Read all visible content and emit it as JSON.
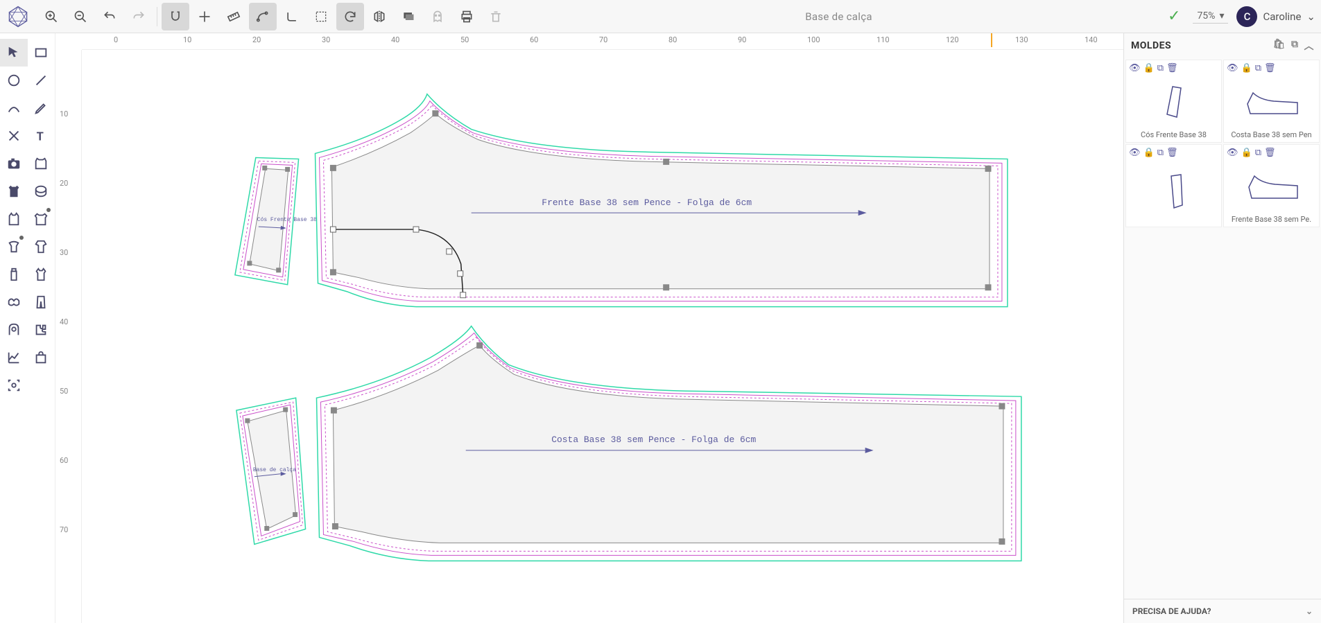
{
  "document_title": "Base de calça",
  "zoom_level": "75%",
  "user": {
    "initial": "C",
    "name": "Caroline"
  },
  "ruler_h": [
    "0",
    "10",
    "20",
    "30",
    "40",
    "50",
    "60",
    "70",
    "80",
    "90",
    "100",
    "110",
    "120",
    "130",
    "140"
  ],
  "ruler_v": [
    "10",
    "20",
    "30",
    "40",
    "50",
    "60",
    "70"
  ],
  "patterns_on_canvas": [
    {
      "label": "Frente Base 38 sem Pence - Folga de 6cm"
    },
    {
      "label": "Costa Base 38 sem Pence - Folga de 6cm"
    },
    {
      "label_small_1": "Cós Frente Base 38"
    },
    {
      "label_small_2": "Base de calça"
    }
  ],
  "side_panel": {
    "title": "MOLDES",
    "items": [
      {
        "name": "Cós Frente Base 38"
      },
      {
        "name": "Costa Base 38 sem Pen"
      },
      {
        "name": ""
      },
      {
        "name": "Frente Base 38 sem Pe."
      }
    ]
  },
  "help_label": "PRECISA DE AJUDA?"
}
